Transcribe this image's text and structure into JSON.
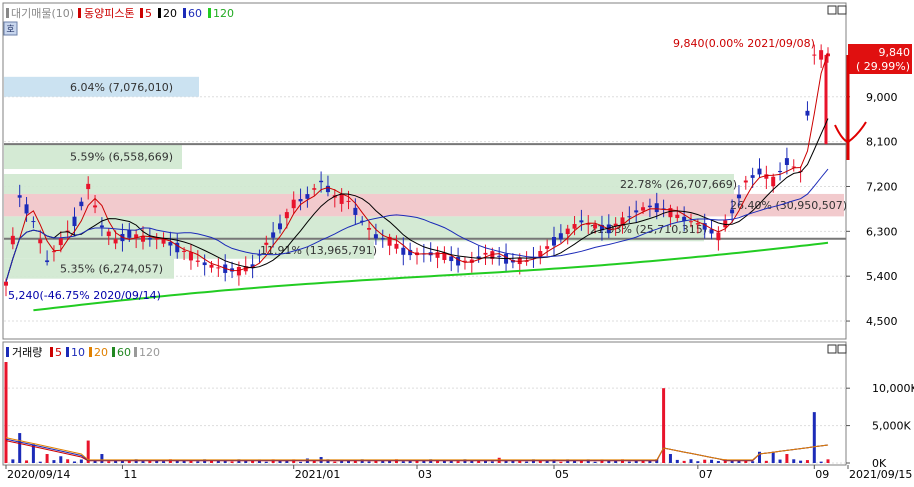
{
  "colors": {
    "up": "#e8132b",
    "down": "#1c2bb8",
    "ma5": "#cc0000",
    "ma20": "#000000",
    "ma60": "#1c2bb8",
    "ma120": "#22cc22",
    "vol_ma5": "#cc0000",
    "vol_ma10": "#1c2bb8",
    "vol_ma20": "#e08000",
    "vol_ma60": "#228822",
    "vol_ma120": "#999999",
    "band_green": "#cfe8cf",
    "band_red": "#f1c4c8",
    "band_blue": "#c5dff0",
    "annot_red": "#cc0000",
    "last_price_bg": "#e01010"
  },
  "price_legend": {
    "pad_label": "대기매물(10)",
    "name": "동양피스톤",
    "ma5": "5",
    "ma20": "20",
    "ma60": "60",
    "ma120": "120"
  },
  "volume_legend": {
    "title": "거래량",
    "ma5": "5",
    "ma10": "10",
    "ma20": "20",
    "ma60": "60",
    "ma120": "120"
  },
  "price_axis": {
    "ticks": [
      "9,000",
      "8,100",
      "7,200",
      "6,300",
      "5,400",
      "4,500"
    ],
    "tick_values": [
      9000,
      8100,
      7200,
      6300,
      5400,
      4500
    ],
    "range": [
      4200,
      10500
    ]
  },
  "volume_axis": {
    "ticks": [
      "10,000K",
      "5,000K",
      "0K"
    ],
    "tick_values": [
      10000,
      5000,
      0
    ],
    "range": [
      0,
      13500
    ]
  },
  "date_axis": {
    "labels": [
      "2020/09/14",
      "11",
      "2021/01",
      "03",
      "05",
      "07",
      "09",
      "2021/09/15"
    ]
  },
  "annotations": {
    "high": "9,840(0.00% 2021/09/08)",
    "low": "5,240(-46.75% 2020/09/14)",
    "last_price": "9,840",
    "last_change": "( 29.99%)",
    "side_button": "호"
  },
  "chart_data": {
    "type": "candlestick",
    "title": "동양피스톤",
    "start_date": "2020/09/14",
    "end_date": "2021/09/15",
    "high": {
      "value": 9840,
      "date": "2021/09/08"
    },
    "low": {
      "value": 5240,
      "date": "2020/09/14"
    },
    "supply_zones": [
      {
        "label": "6.04% (7,076,010)",
        "price_from": 9000,
        "price_to": 9400,
        "volume_share": 6.04,
        "volume": 7076010
      },
      {
        "label": "5.59% (6,558,669)",
        "price_from": 7550,
        "price_to": 8050,
        "volume_share": 5.59,
        "volume": 6558669
      },
      {
        "label": "22.78% (26,707,669)",
        "price_from": 7050,
        "price_to": 7450,
        "volume_share": 22.78,
        "volume": 26707669
      },
      {
        "label": "26.40% (30,950,507)",
        "price_from": 6600,
        "price_to": 7050,
        "volume_share": 26.4,
        "volume": 30950507
      },
      {
        "label": "21.93% (25,710,315)",
        "price_from": 6100,
        "price_to": 6600,
        "volume_share": 21.93,
        "volume": 25710315
      },
      {
        "label": "11.91% (13,965,791)",
        "price_from": 5750,
        "price_to": 6100,
        "volume_share": 11.91,
        "volume": 13965791
      },
      {
        "label": "5.35% (6,274,057)",
        "price_from": 5350,
        "price_to": 5750,
        "volume_share": 5.35,
        "volume": 6274057
      }
    ],
    "horizontal_lines": [
      8050,
      6150
    ],
    "price_path": [
      [
        0,
        5250
      ],
      [
        2,
        7000
      ],
      [
        4,
        6500
      ],
      [
        6,
        5700
      ],
      [
        8,
        6100
      ],
      [
        10,
        6500
      ],
      [
        12,
        7200
      ],
      [
        14,
        6400
      ],
      [
        16,
        6100
      ],
      [
        18,
        6250
      ],
      [
        20,
        6150
      ],
      [
        22,
        6150
      ],
      [
        24,
        6050
      ],
      [
        26,
        5900
      ],
      [
        28,
        5700
      ],
      [
        30,
        5600
      ],
      [
        32,
        5550
      ],
      [
        34,
        5500
      ],
      [
        36,
        5600
      ],
      [
        38,
        6050
      ],
      [
        40,
        6400
      ],
      [
        42,
        6850
      ],
      [
        44,
        7000
      ],
      [
        46,
        7300
      ],
      [
        48,
        7000
      ],
      [
        50,
        6900
      ],
      [
        52,
        6500
      ],
      [
        54,
        6200
      ],
      [
        56,
        6100
      ],
      [
        58,
        5900
      ],
      [
        60,
        5850
      ],
      [
        62,
        5850
      ],
      [
        64,
        5800
      ],
      [
        66,
        5700
      ],
      [
        68,
        5700
      ],
      [
        70,
        5850
      ],
      [
        72,
        5800
      ],
      [
        74,
        5700
      ],
      [
        76,
        5700
      ],
      [
        78,
        5850
      ],
      [
        80,
        6100
      ],
      [
        82,
        6300
      ],
      [
        84,
        6500
      ],
      [
        86,
        6400
      ],
      [
        88,
        6350
      ],
      [
        90,
        6500
      ],
      [
        92,
        6700
      ],
      [
        94,
        6800
      ],
      [
        96,
        6750
      ],
      [
        98,
        6600
      ],
      [
        100,
        6500
      ],
      [
        102,
        6400
      ],
      [
        104,
        6200
      ],
      [
        106,
        6700
      ],
      [
        108,
        7300
      ],
      [
        110,
        7500
      ],
      [
        112,
        7300
      ],
      [
        114,
        7700
      ],
      [
        116,
        7500
      ],
      [
        118,
        9840
      ],
      [
        120,
        9840
      ]
    ],
    "volume_bars_k": [
      [
        0,
        13500
      ],
      [
        2,
        4000
      ],
      [
        4,
        2500
      ],
      [
        6,
        1200
      ],
      [
        8,
        900
      ],
      [
        12,
        3000
      ],
      [
        14,
        1200
      ],
      [
        30,
        400
      ],
      [
        44,
        600
      ],
      [
        46,
        800
      ],
      [
        72,
        700
      ],
      [
        96,
        10000
      ],
      [
        97,
        1200
      ],
      [
        110,
        1500
      ],
      [
        112,
        1500
      ],
      [
        114,
        1200
      ],
      [
        118,
        6800
      ]
    ]
  }
}
